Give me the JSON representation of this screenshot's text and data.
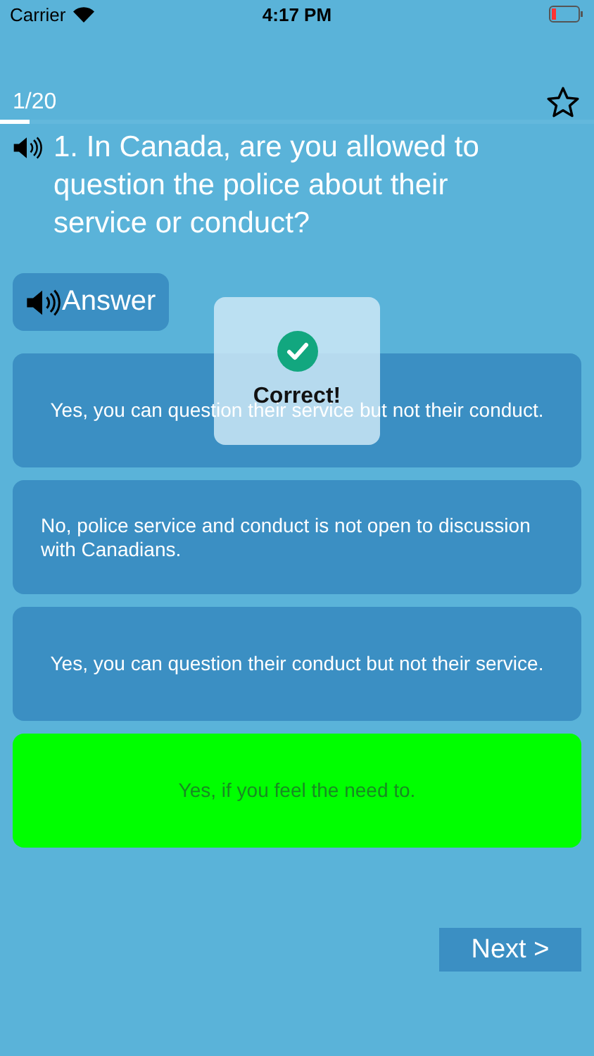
{
  "status_bar": {
    "carrier": "Carrier",
    "time": "4:17 PM",
    "battery_low": true
  },
  "progress": {
    "label": "1/20",
    "level": 0.05
  },
  "favorite": {
    "selected": false
  },
  "question": {
    "text": "1. In Canada, are you allowed to question the police about their service or conduct?"
  },
  "answer_button": {
    "label": "Answer"
  },
  "options": [
    {
      "text": "Yes, you can question their service but not their conduct.",
      "correct": false
    },
    {
      "text": "No, police service and conduct is not open to discussion with Canadians.",
      "correct": false
    },
    {
      "text": "Yes, you can question their conduct but not their service.",
      "correct": false
    },
    {
      "text": "Yes, if you feel the need to.",
      "correct": true
    }
  ],
  "feedback": {
    "kind": "correct",
    "text": "Correct!"
  },
  "next_button": {
    "label": "Next >"
  }
}
